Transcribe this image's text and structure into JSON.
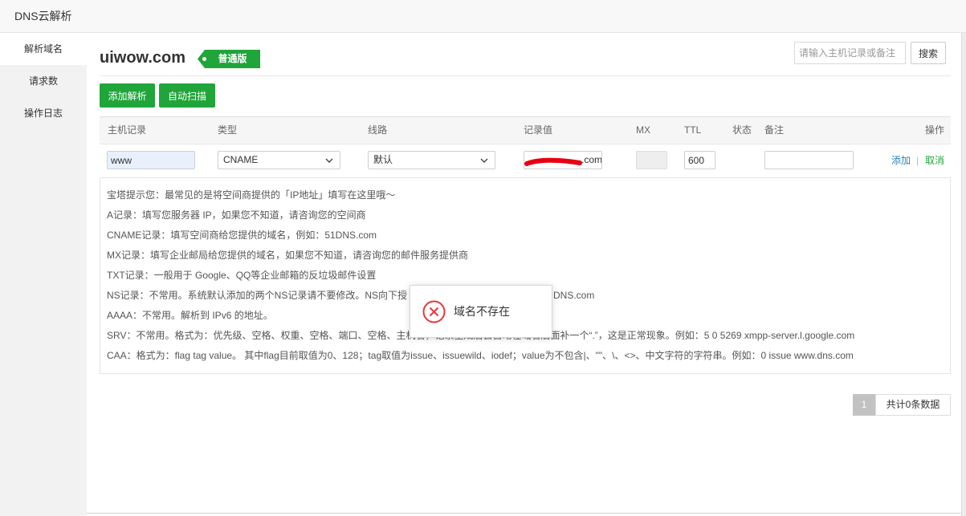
{
  "window": {
    "title": "DNS云解析"
  },
  "sidebar": {
    "items": [
      {
        "label": "解析域名",
        "active": true
      },
      {
        "label": "请求数",
        "active": false
      },
      {
        "label": "操作日志",
        "active": false
      }
    ]
  },
  "header": {
    "domain": "uiwow.com",
    "edition_badge": "普通版",
    "search": {
      "placeholder": "请输入主机记录或备注"
    },
    "search_button": "搜索"
  },
  "toolbar": {
    "add_record": "添加解析",
    "auto_scan": "自动扫描"
  },
  "table": {
    "columns": {
      "host": "主机记录",
      "type": "类型",
      "line": "线路",
      "value": "记录值",
      "mx": "MX",
      "ttl": "TTL",
      "status": "状态",
      "remark": "备注",
      "actions": "操作"
    },
    "edit_row": {
      "host": "www",
      "type": "CNAME",
      "line": "默认",
      "value": {
        "visible_text": ".com",
        "redacted": true
      },
      "mx": {
        "value": "",
        "disabled": true
      },
      "ttl": "600",
      "status": "",
      "remark": "",
      "actions": {
        "add": "添加",
        "separator": "|",
        "cancel": "取消"
      }
    }
  },
  "tips": {
    "lines": [
      "宝塔提示您：最常见的是将空间商提供的「IP地址」填写在这里哦～",
      "A记录：填写您服务器 IP，如果您不知道，请咨询您的空间商",
      "CNAME记录：填写空间商给您提供的域名，例如：51DNS.com",
      "MX记录：填写企业邮局给您提供的域名，如果您不知道，请咨询您的邮件服务提供商",
      "TXT记录：一般用于 Google、QQ等企业邮箱的反垃圾邮件设置",
      {
        "visible_start": "NS记录：不常用。系统默认添加的两个NS记录请不要修改。NS向下授",
        "visible_end": "DNS.com"
      },
      "AAAA：不常用。解析到 IPv6 的地址。",
      "SRV：不常用。格式为：优先级、空格、权重、空格、端口、空格、主机名，记录生成后会自动在域名后面补一个“.”，这是正常现象。例如：5 0 5269 xmpp-server.l.google.com",
      "CAA：格式为：flag tag value。 其中flag目前取值为0、128；tag取值为issue、issuewild、iodef；value为不包含|、\"\"、\\、<>、中文字符的字符串。例如：0 issue www.dns.com"
    ]
  },
  "toast": {
    "icon": "error-circle-x-icon",
    "message": "域名不存在"
  },
  "pagination": {
    "current_page": "1",
    "summary": "共计0条数据"
  },
  "icons": {
    "select_arrow": "chevron-down-icon",
    "redaction": "redaction-scribble"
  },
  "colors": {
    "accent": "#20a53a",
    "link_add": "#2d7fb8",
    "link_cancel": "#20a53a",
    "error": "#e5393c",
    "redaction": "#e60012",
    "autofill_bg": "#e8f0fe"
  }
}
